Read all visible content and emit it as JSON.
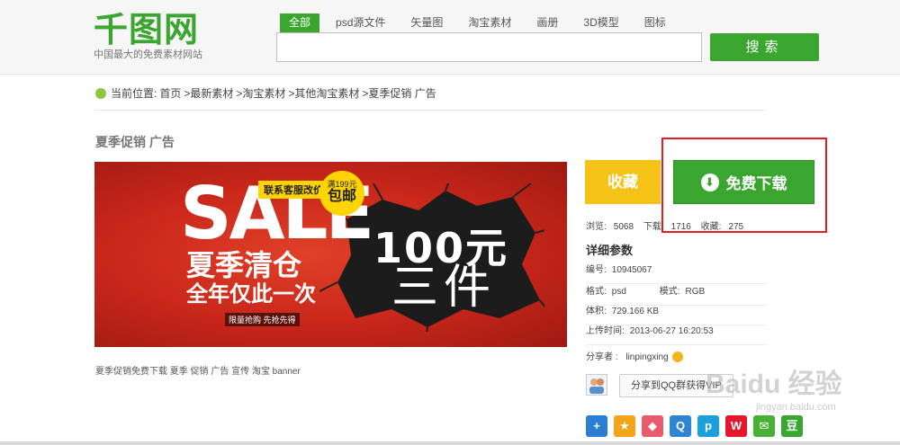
{
  "header": {
    "logo_text": "千图网",
    "logo_sub": "中国最大的免费素材网站",
    "tabs": [
      {
        "label": "全部",
        "active": true
      },
      {
        "label": "psd源文件"
      },
      {
        "label": "矢量图"
      },
      {
        "label": "淘宝素材"
      },
      {
        "label": "画册"
      },
      {
        "label": "3D模型"
      },
      {
        "label": "图标"
      }
    ],
    "search_value": "",
    "search_button": "搜索"
  },
  "breadcrumb": {
    "prefix": "当前位置:",
    "items": [
      "首页",
      ">最新素材",
      ">淘宝素材",
      ">其他淘宝素材",
      ">夏季促销 广告"
    ]
  },
  "page_title": "夏季促销 广告",
  "banner": {
    "tag": "联系客服改价",
    "circle_top": "满199元",
    "circle_main": "包邮",
    "sale": "SALE",
    "line1": "夏季清仓",
    "line2": "全年仅此一次",
    "small": "限量抢购 先抢先得",
    "price": "100元",
    "count": "三件"
  },
  "caption": "夏季促销免费下载 夏季 促销 广告 宣传 淘宝 banner",
  "actions": {
    "favorite": "收藏",
    "download": "免费下载"
  },
  "stats": {
    "views_label": "浏览:",
    "views": "5068",
    "downloads_label": "下载:",
    "downloads": "1716",
    "favorites_label": "收藏:",
    "favorites": "275"
  },
  "details": {
    "heading": "详细参数",
    "id_label": "编号:",
    "id": "10945067",
    "format_label": "格式:",
    "format": "psd",
    "mode_label": "模式:",
    "mode": "RGB",
    "size_label": "体积:",
    "size": "729.166 KB",
    "upload_label": "上传时间:",
    "upload": "2013-06-27 16:20:53"
  },
  "sharer": {
    "label": "分享者 :",
    "name": "linpingxing"
  },
  "qq_share": "分享到QQ群获得VIP",
  "share_icons": [
    {
      "name": "plus-share-icon",
      "glyph": "+",
      "color": "#2a7fd4"
    },
    {
      "name": "qzone-icon",
      "glyph": "★",
      "color": "#f2a51a"
    },
    {
      "name": "renren-icon",
      "glyph": "◆",
      "color": "#e85a6c"
    },
    {
      "name": "qq-icon",
      "glyph": "Q",
      "color": "#2f85d1"
    },
    {
      "name": "pengyou-icon",
      "glyph": "p",
      "color": "#1aa0db"
    },
    {
      "name": "weibo-icon",
      "glyph": "W",
      "color": "#e6162d"
    },
    {
      "name": "wechat-icon",
      "glyph": "✉",
      "color": "#48b135"
    },
    {
      "name": "douban-icon",
      "glyph": "豆",
      "color": "#3aa52f"
    }
  ],
  "watermark": "Baidu 经验",
  "watermark_sub": "jingyan.baidu.com"
}
